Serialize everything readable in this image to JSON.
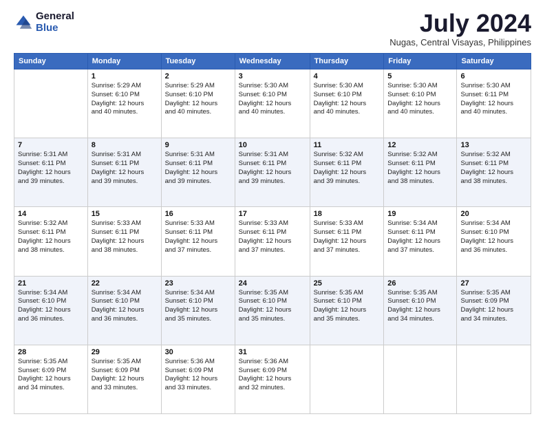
{
  "header": {
    "logo_line1": "General",
    "logo_line2": "Blue",
    "month_title": "July 2024",
    "location": "Nugas, Central Visayas, Philippines"
  },
  "weekdays": [
    "Sunday",
    "Monday",
    "Tuesday",
    "Wednesday",
    "Thursday",
    "Friday",
    "Saturday"
  ],
  "weeks": [
    [
      {
        "day": "",
        "text": ""
      },
      {
        "day": "1",
        "text": "Sunrise: 5:29 AM\nSunset: 6:10 PM\nDaylight: 12 hours\nand 40 minutes."
      },
      {
        "day": "2",
        "text": "Sunrise: 5:29 AM\nSunset: 6:10 PM\nDaylight: 12 hours\nand 40 minutes."
      },
      {
        "day": "3",
        "text": "Sunrise: 5:30 AM\nSunset: 6:10 PM\nDaylight: 12 hours\nand 40 minutes."
      },
      {
        "day": "4",
        "text": "Sunrise: 5:30 AM\nSunset: 6:10 PM\nDaylight: 12 hours\nand 40 minutes."
      },
      {
        "day": "5",
        "text": "Sunrise: 5:30 AM\nSunset: 6:10 PM\nDaylight: 12 hours\nand 40 minutes."
      },
      {
        "day": "6",
        "text": "Sunrise: 5:30 AM\nSunset: 6:11 PM\nDaylight: 12 hours\nand 40 minutes."
      }
    ],
    [
      {
        "day": "7",
        "text": "Sunrise: 5:31 AM\nSunset: 6:11 PM\nDaylight: 12 hours\nand 39 minutes."
      },
      {
        "day": "8",
        "text": "Sunrise: 5:31 AM\nSunset: 6:11 PM\nDaylight: 12 hours\nand 39 minutes."
      },
      {
        "day": "9",
        "text": "Sunrise: 5:31 AM\nSunset: 6:11 PM\nDaylight: 12 hours\nand 39 minutes."
      },
      {
        "day": "10",
        "text": "Sunrise: 5:31 AM\nSunset: 6:11 PM\nDaylight: 12 hours\nand 39 minutes."
      },
      {
        "day": "11",
        "text": "Sunrise: 5:32 AM\nSunset: 6:11 PM\nDaylight: 12 hours\nand 39 minutes."
      },
      {
        "day": "12",
        "text": "Sunrise: 5:32 AM\nSunset: 6:11 PM\nDaylight: 12 hours\nand 38 minutes."
      },
      {
        "day": "13",
        "text": "Sunrise: 5:32 AM\nSunset: 6:11 PM\nDaylight: 12 hours\nand 38 minutes."
      }
    ],
    [
      {
        "day": "14",
        "text": "Sunrise: 5:32 AM\nSunset: 6:11 PM\nDaylight: 12 hours\nand 38 minutes."
      },
      {
        "day": "15",
        "text": "Sunrise: 5:33 AM\nSunset: 6:11 PM\nDaylight: 12 hours\nand 38 minutes."
      },
      {
        "day": "16",
        "text": "Sunrise: 5:33 AM\nSunset: 6:11 PM\nDaylight: 12 hours\nand 37 minutes."
      },
      {
        "day": "17",
        "text": "Sunrise: 5:33 AM\nSunset: 6:11 PM\nDaylight: 12 hours\nand 37 minutes."
      },
      {
        "day": "18",
        "text": "Sunrise: 5:33 AM\nSunset: 6:11 PM\nDaylight: 12 hours\nand 37 minutes."
      },
      {
        "day": "19",
        "text": "Sunrise: 5:34 AM\nSunset: 6:11 PM\nDaylight: 12 hours\nand 37 minutes."
      },
      {
        "day": "20",
        "text": "Sunrise: 5:34 AM\nSunset: 6:10 PM\nDaylight: 12 hours\nand 36 minutes."
      }
    ],
    [
      {
        "day": "21",
        "text": "Sunrise: 5:34 AM\nSunset: 6:10 PM\nDaylight: 12 hours\nand 36 minutes."
      },
      {
        "day": "22",
        "text": "Sunrise: 5:34 AM\nSunset: 6:10 PM\nDaylight: 12 hours\nand 36 minutes."
      },
      {
        "day": "23",
        "text": "Sunrise: 5:34 AM\nSunset: 6:10 PM\nDaylight: 12 hours\nand 35 minutes."
      },
      {
        "day": "24",
        "text": "Sunrise: 5:35 AM\nSunset: 6:10 PM\nDaylight: 12 hours\nand 35 minutes."
      },
      {
        "day": "25",
        "text": "Sunrise: 5:35 AM\nSunset: 6:10 PM\nDaylight: 12 hours\nand 35 minutes."
      },
      {
        "day": "26",
        "text": "Sunrise: 5:35 AM\nSunset: 6:10 PM\nDaylight: 12 hours\nand 34 minutes."
      },
      {
        "day": "27",
        "text": "Sunrise: 5:35 AM\nSunset: 6:09 PM\nDaylight: 12 hours\nand 34 minutes."
      }
    ],
    [
      {
        "day": "28",
        "text": "Sunrise: 5:35 AM\nSunset: 6:09 PM\nDaylight: 12 hours\nand 34 minutes."
      },
      {
        "day": "29",
        "text": "Sunrise: 5:35 AM\nSunset: 6:09 PM\nDaylight: 12 hours\nand 33 minutes."
      },
      {
        "day": "30",
        "text": "Sunrise: 5:36 AM\nSunset: 6:09 PM\nDaylight: 12 hours\nand 33 minutes."
      },
      {
        "day": "31",
        "text": "Sunrise: 5:36 AM\nSunset: 6:09 PM\nDaylight: 12 hours\nand 32 minutes."
      },
      {
        "day": "",
        "text": ""
      },
      {
        "day": "",
        "text": ""
      },
      {
        "day": "",
        "text": ""
      }
    ]
  ]
}
